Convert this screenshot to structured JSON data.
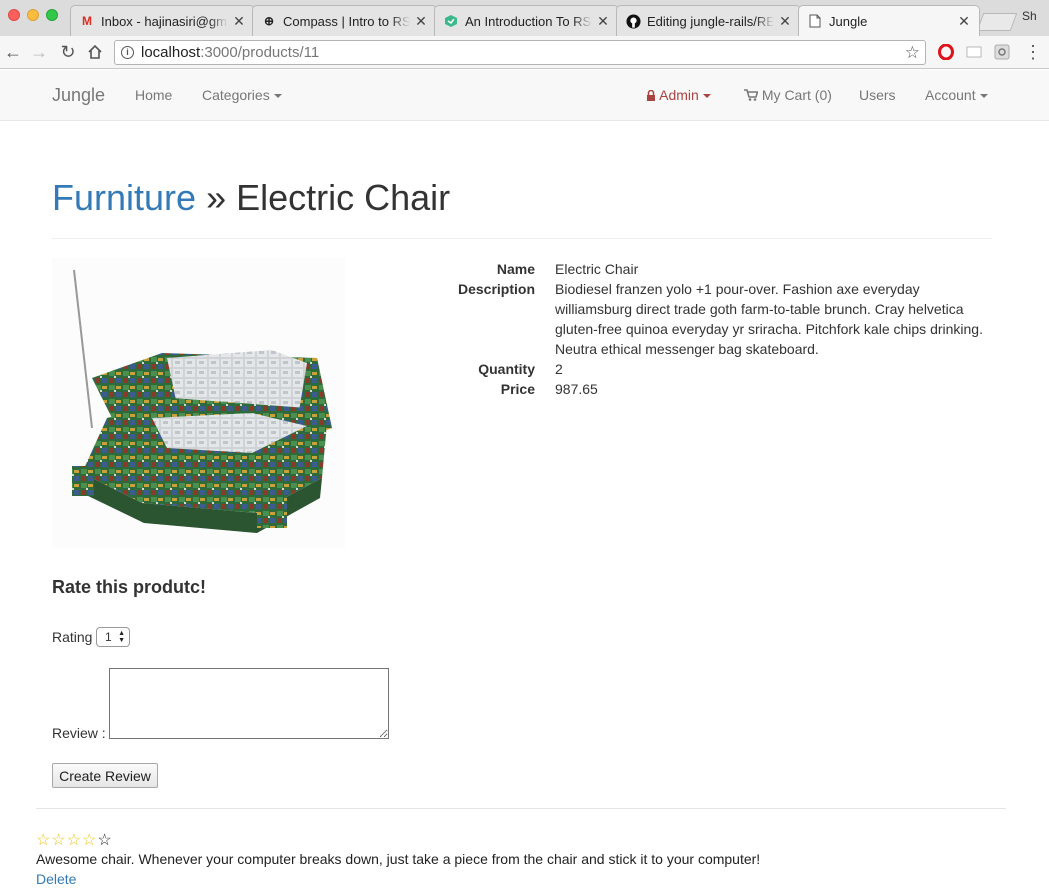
{
  "browser": {
    "tabs": [
      {
        "title": "Inbox - hajinasiri@gmail.com",
        "icon": "gmail-icon",
        "active": false
      },
      {
        "title": "Compass | Intro to RSpec",
        "icon": "compass-icon",
        "active": false
      },
      {
        "title": "An Introduction To RSpec",
        "icon": "book-icon",
        "active": false
      },
      {
        "title": "Editing jungle-rails/README",
        "icon": "github-icon",
        "active": false
      },
      {
        "title": "Jungle",
        "icon": "page-icon",
        "active": true
      }
    ],
    "profile": "Sh",
    "url_host": "localhost",
    "url_path": ":3000/products/11"
  },
  "navbar": {
    "brand": "Jungle",
    "home": "Home",
    "categories": "Categories",
    "admin": "Admin",
    "cart": "My Cart (0)",
    "users": "Users",
    "account": "Account"
  },
  "product": {
    "category": "Furniture",
    "separator": " » ",
    "name": "Electric Chair",
    "labels": {
      "name": "Name",
      "description": "Description",
      "quantity": "Quantity",
      "price": "Price"
    },
    "description": "Biodiesel franzen yolo +1 pour-over. Fashion axe everyday williamsburg direct trade goth farm-to-table brunch. Cray helvetica gluten-free quinoa everyday yr sriracha. Pitchfork kale chips drinking. Neutra ethical messenger bag skateboard.",
    "quantity": "2",
    "price": "987.65"
  },
  "review_form": {
    "heading": "Rate this produtc!",
    "rating_label": "Rating",
    "rating_value": "1",
    "review_label": "Review :",
    "submit_label": "Create Review"
  },
  "reviews": [
    {
      "rating": 4,
      "max_rating": 5,
      "text": "Awesome chair. Whenever your computer breaks down, just take a piece from the chair and stick it to your computer!",
      "delete_label": "Delete"
    }
  ],
  "colors": {
    "link": "#337ab7",
    "admin": "#a94442",
    "star_filled": "#f0c419"
  }
}
